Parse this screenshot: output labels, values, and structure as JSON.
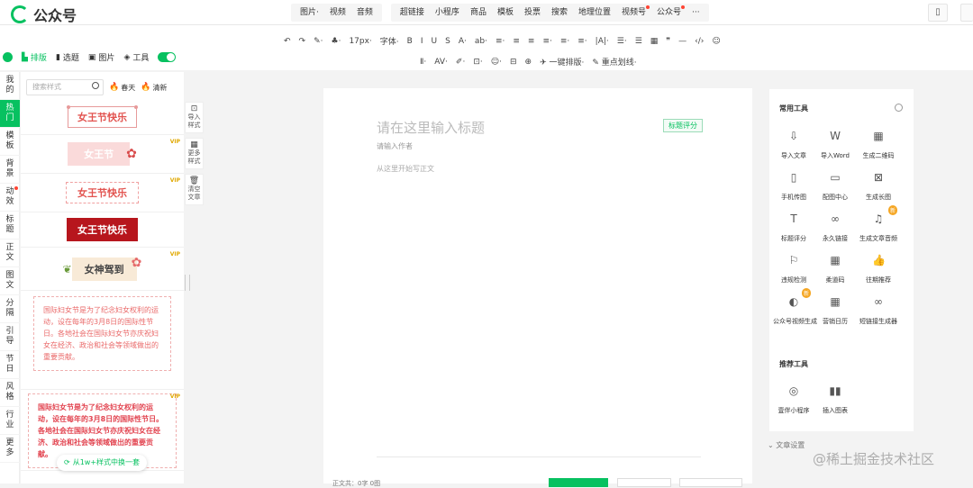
{
  "app": {
    "name": "公众号"
  },
  "topnav": {
    "groups": [
      [
        {
          "label": "图片·",
          "dot": false
        },
        {
          "label": "视频",
          "dot": false
        },
        {
          "label": "音频",
          "dot": false
        }
      ],
      [
        {
          "label": "超链接",
          "dot": false
        },
        {
          "label": "小程序",
          "dot": false
        },
        {
          "label": "商品",
          "dot": false
        },
        {
          "label": "模板",
          "dot": false
        },
        {
          "label": "投票",
          "dot": false
        },
        {
          "label": "搜索",
          "dot": false
        },
        {
          "label": "地理位置",
          "dot": false
        },
        {
          "label": "视频号",
          "dot": true
        },
        {
          "label": "公众号",
          "dot": true
        },
        {
          "label": "···",
          "dot": false
        }
      ]
    ]
  },
  "toolbar": {
    "row1": [
      "↶",
      "↷",
      "✎·",
      "♣·",
      "17px·",
      "字体·",
      "B",
      "I",
      "U",
      "S",
      "A·",
      "ab·",
      "≡·",
      "≡",
      "≡",
      "≡·",
      "≡·",
      "≡·",
      "|A|·",
      "☰·",
      "☰",
      "▦",
      "❞",
      "—",
      "‹/›",
      "☺"
    ],
    "row2": [
      "Ⅱ·",
      "AV·",
      "✐·",
      "⊡·",
      "☺·",
      "⊟",
      "⊕",
      "✈ 一键排版·",
      "✎ 重点划线·"
    ]
  },
  "modes": {
    "items": [
      {
        "label": "排版",
        "active": true
      },
      {
        "label": "选题",
        "active": false
      },
      {
        "label": "图片",
        "active": false
      },
      {
        "label": "工具",
        "active": false
      }
    ]
  },
  "categories": [
    {
      "label": "我的",
      "active": false,
      "dot": false
    },
    {
      "label": "热门",
      "active": true,
      "dot": false
    },
    {
      "label": "模板",
      "active": false,
      "dot": false
    },
    {
      "label": "背景",
      "active": false,
      "dot": false
    },
    {
      "label": "动效",
      "active": false,
      "dot": true
    },
    {
      "label": "标题",
      "active": false,
      "dot": false
    },
    {
      "label": "正文",
      "active": false,
      "dot": false
    },
    {
      "label": "图文",
      "active": false,
      "dot": false
    },
    {
      "label": "分隔",
      "active": false,
      "dot": false
    },
    {
      "label": "引导",
      "active": false,
      "dot": false
    },
    {
      "label": "节日",
      "active": false,
      "dot": false
    },
    {
      "label": "风格",
      "active": false,
      "dot": false
    },
    {
      "label": "行业",
      "active": false,
      "dot": false
    },
    {
      "label": "更多",
      "active": false,
      "dot": false
    }
  ],
  "stylepanel": {
    "search_placeholder": "搜索样式",
    "hot1": "春天",
    "hot2": "清新",
    "templates": [
      "女王节快乐",
      "女王节",
      "女王节快乐",
      "女王节快乐",
      "女神驾到"
    ],
    "vip_label": "VIP",
    "para1": "国际妇女节是为了纪念妇女权利的运动，设在每年的3月8日的国际性节日。各地社会在国际妇女节亦庆祝妇女在经济、政治和社会等领域做出的重要贡献。",
    "para2": "国际妇女节是为了纪念妇女权利的运动，设在每年的3月8日的国际性节日。各地社会在国际妇女节亦庆祝妇女在经济、政治和社会等领域做出的重要贡献。",
    "switch_label": "从1w+样式中换一套"
  },
  "sidetools": [
    {
      "icon": "⊡",
      "label": "导入样式"
    },
    {
      "icon": "▦",
      "label": "更多样式"
    },
    {
      "icon": "🗑",
      "label": "清空文章"
    }
  ],
  "editor": {
    "title_placeholder": "请在这里输入标题",
    "title_badge": "标题评分",
    "author_placeholder": "请输入作者",
    "body_placeholder": "从这里开始写正文",
    "footer_text": "正文共：0字 0图"
  },
  "tools": {
    "common_title": "常用工具",
    "common": [
      {
        "icon": "⇩",
        "label": "导入文章",
        "badge": ""
      },
      {
        "icon": "W",
        "label": "导入Word",
        "badge": ""
      },
      {
        "icon": "▦",
        "label": "生成二维码",
        "badge": ""
      },
      {
        "icon": "▯",
        "label": "手机传图",
        "badge": ""
      },
      {
        "icon": "▭",
        "label": "配图中心",
        "badge": ""
      },
      {
        "icon": "⊠",
        "label": "生成长图",
        "badge": ""
      },
      {
        "icon": "T",
        "label": "标题评分",
        "badge": ""
      },
      {
        "icon": "∞",
        "label": "永久链接",
        "badge": ""
      },
      {
        "icon": "♫",
        "label": "生成文章音频",
        "badge": "新"
      },
      {
        "icon": "⚐",
        "label": "违规检测",
        "badge": ""
      },
      {
        "icon": "▦",
        "label": "柔道码",
        "badge": ""
      },
      {
        "icon": "👍",
        "label": "往期推荐",
        "badge": ""
      },
      {
        "icon": "◐",
        "label": "公众号视频生成",
        "badge": "新"
      },
      {
        "icon": "▦",
        "label": "营销日历",
        "badge": ""
      },
      {
        "icon": "∞",
        "label": "短链接生成器",
        "badge": ""
      }
    ],
    "rec_title": "推荐工具",
    "rec": [
      {
        "icon": "◎",
        "label": "壹伴小程序",
        "badge": ""
      },
      {
        "icon": "▮▮",
        "label": "插入图表",
        "badge": ""
      }
    ]
  },
  "settings_link": "文章设置",
  "watermark": "@稀土掘金技术社区"
}
